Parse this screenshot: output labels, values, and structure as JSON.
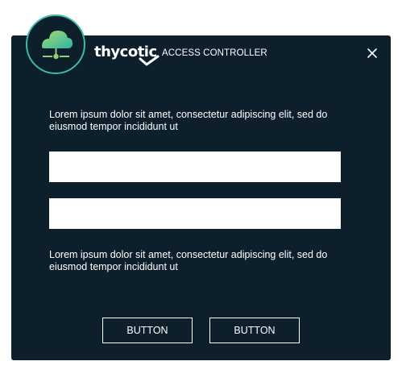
{
  "brand": {
    "wordmark": "thycotic",
    "product": "ACCESS CONTROLLER",
    "logo_icon": "cloud-network-icon"
  },
  "dialog": {
    "close_icon": "close-icon",
    "intro_text": "Lorem ipsum dolor sit amet, consectetur adipiscing elit, sed do eiusmod tempor incididunt ut",
    "fields": [
      {
        "value": "",
        "placeholder": ""
      },
      {
        "value": "",
        "placeholder": ""
      }
    ],
    "footer_text": "Lorem ipsum dolor sit amet, consectetur adipiscing elit, sed do eiusmod tempor incididunt ut",
    "buttons": [
      {
        "label": "BUTTON"
      },
      {
        "label": "BUTTON"
      }
    ]
  },
  "colors": {
    "dialog_background": "#0c1f2b",
    "accent_teal": "#3fb8a6",
    "logo_green": "#8ed17a",
    "text": "#ffffff"
  }
}
